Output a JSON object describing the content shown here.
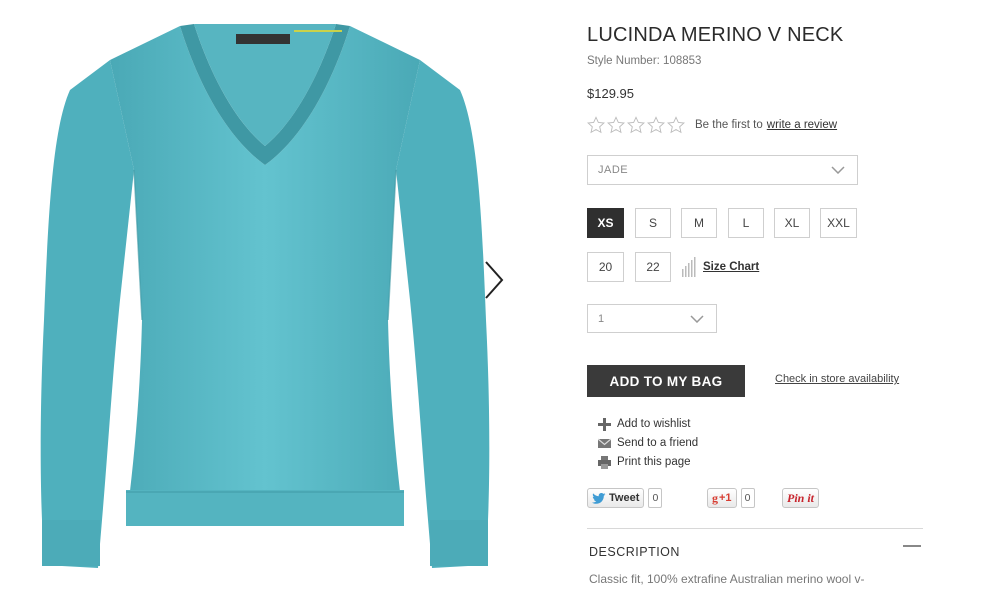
{
  "product": {
    "title": "LUCINDA MERINO V NECK",
    "style_number": "Style Number: 108853",
    "price": "$129.95",
    "color_accent": "#5bb9c5",
    "image_label": "sweater-product-image"
  },
  "rating": {
    "stars_filled": 0,
    "stars_total": 5,
    "prompt": "Be the first to",
    "link": "write a review"
  },
  "color_select": {
    "value": "JADE"
  },
  "sizes": [
    {
      "label": "XS",
      "selected": true
    },
    {
      "label": "S",
      "selected": false
    },
    {
      "label": "M",
      "selected": false
    },
    {
      "label": "L",
      "selected": false
    },
    {
      "label": "XL",
      "selected": false
    },
    {
      "label": "XXL",
      "selected": false
    },
    {
      "label": "20",
      "selected": false
    },
    {
      "label": "22",
      "selected": false
    }
  ],
  "size_chart": {
    "label": "Size Chart",
    "icon": "ruler-bars-icon"
  },
  "quantity_select": {
    "value": "1"
  },
  "add_to_bag": {
    "label": "ADD TO MY BAG"
  },
  "store_availability": {
    "label": "Check in store availability"
  },
  "actions": [
    {
      "label": "Add to wishlist",
      "icon": "plus-icon"
    },
    {
      "label": "Send to a friend",
      "icon": "envelope-icon"
    },
    {
      "label": "Print this page",
      "icon": "printer-icon"
    }
  ],
  "social": {
    "tweet": {
      "label": "Tweet",
      "count": "0"
    },
    "gplus": {
      "label": "+1",
      "count": "0"
    },
    "pinterest": {
      "label": "Pin it"
    }
  },
  "description": {
    "heading": "DESCRIPTION",
    "text": "Classic fit, 100% extrafine Australian merino wool v-"
  }
}
